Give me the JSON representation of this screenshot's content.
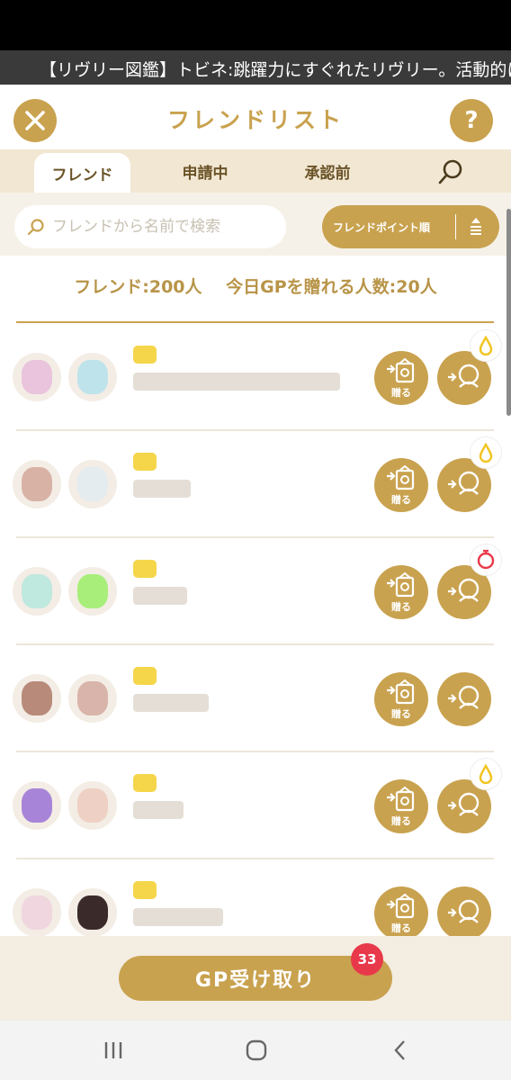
{
  "ticker": {
    "text": "【リヴリー図鑑】トビネ:跳躍力にすぐれたリヴリー。活動的に飛"
  },
  "header": {
    "title": "フレンドリスト",
    "help_label": "?"
  },
  "tabs": [
    {
      "label": "フレンド"
    },
    {
      "label": "申請中"
    },
    {
      "label": "承認前"
    }
  ],
  "search": {
    "placeholder": "フレンドから名前で検索"
  },
  "sort": {
    "label": "フレンドポイント順"
  },
  "summary": {
    "friends": "フレンド:200人",
    "gp_count": "今日GPを贈れる人数:20人"
  },
  "friends": [
    {
      "gift_label": "贈る",
      "status": "drop"
    },
    {
      "gift_label": "贈る",
      "status": "drop"
    },
    {
      "gift_label": "贈る",
      "status": "timer"
    },
    {
      "gift_label": "贈る",
      "status": "none"
    },
    {
      "gift_label": "贈る",
      "status": "drop"
    },
    {
      "gift_label": "贈る",
      "status": "none"
    }
  ],
  "gp_receive": {
    "label": "GP受け取り",
    "count": "33"
  },
  "colors": {
    "gold": "#c9a24f",
    "tab_bg": "#f2e7d3",
    "badge_red": "#e8394a"
  }
}
